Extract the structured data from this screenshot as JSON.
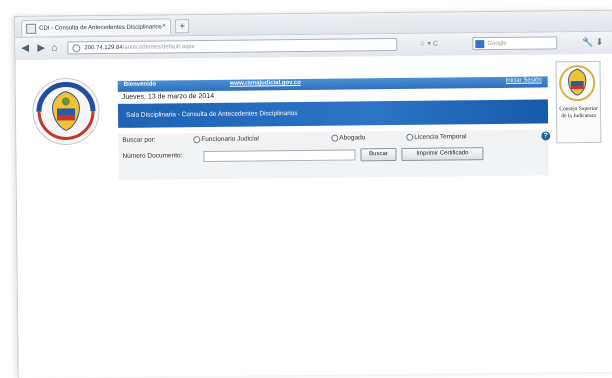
{
  "browser": {
    "tab_title": "CDI - Consulta de Antecedentes Disciplinarios",
    "tab_close": "×",
    "new_tab": "+",
    "url_host": "200.74.129.84",
    "url_path": "/antecedentes/default.aspx",
    "search_placeholder": "Google",
    "back": "◀",
    "forward": "▶",
    "home": "⌂",
    "star_reload": "☆ ▾ C",
    "tools": "🔧  ⬇"
  },
  "header": {
    "welcome": "Bienvenido",
    "site_link": "www.ramajudicial.gov.co",
    "start_link": "Iniciar Sesión",
    "date": "Jueves, 13 de marzo de 2014",
    "banner": "Sala Disciplinaria - Consulta de Antecedentes Disciplinarios"
  },
  "form": {
    "search_by_label": "Buscar por:",
    "options": [
      "Funcionario Judicial",
      "Abogado",
      "Licencia Temporal"
    ],
    "doc_label": "Número Documento:",
    "doc_value": "",
    "search_button": "Buscar",
    "print_button": "Imprimir Certificado",
    "help": "?"
  },
  "seal_right_caption": "Consejo Superior de la Judicatura"
}
